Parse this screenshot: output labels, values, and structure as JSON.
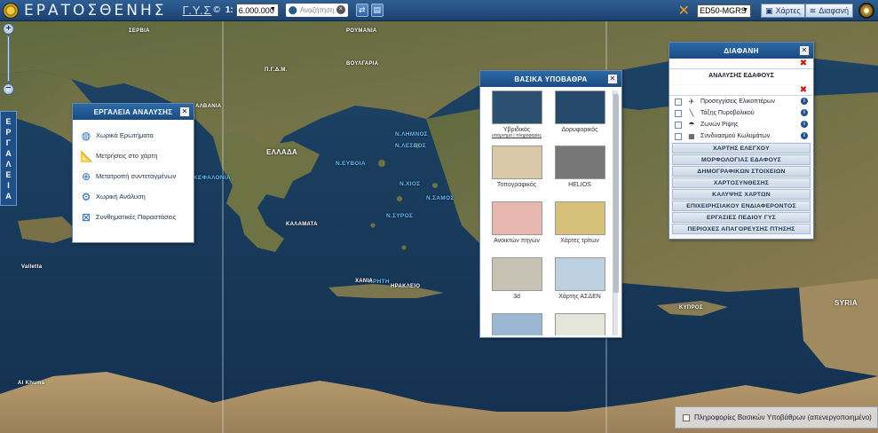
{
  "header": {
    "title": "ΕΡΑΤΟΣΘΕΝΗΣ",
    "gis_logo": "Γ.Υ.Σ",
    "copyright": "©",
    "scale_prefix": "1:",
    "scale_value": "6.000.000",
    "search_placeholder": "Αναζήτηση",
    "coordinate_system": "ED50-MGRS",
    "maps_label": "Χάρτες",
    "legend_label": "Διαφανή"
  },
  "left_tools": {
    "tab_letters": [
      "Ε",
      "Ρ",
      "Γ",
      "Α",
      "Λ",
      "Ε",
      "Ι",
      "Α"
    ]
  },
  "analysis_panel": {
    "title": "ΕΡΓΑΛΕΙΑ ΑΝΑΛΥΣΗΣ",
    "items": [
      {
        "label": "Χωρικά Ερωτήματα",
        "icon": "globe-icon"
      },
      {
        "label": "Μετρήσεις στο χάρτη",
        "icon": "ruler-icon"
      },
      {
        "label": "Μετατροπή συντεταγμένων",
        "icon": "crosshair-icon"
      },
      {
        "label": "Χωρική Ανάλυση",
        "icon": "gear-icon"
      },
      {
        "label": "Συνθηματικές Παραστάσεις",
        "icon": "tactical-symbol-icon"
      }
    ]
  },
  "basemaps_panel": {
    "title": "ΒΑΣΙΚΑ ΥΠΟΒΑΘΡΑ",
    "items": [
      {
        "label": "Υβριδικός",
        "sub": "υπόμνημα | πληροφορίες",
        "swatch": "#2c5070"
      },
      {
        "label": "Δορυφορικός",
        "sub": "",
        "swatch": "#24496b"
      },
      {
        "label": "Τοπογραφικός",
        "sub": "",
        "swatch": "#d9c9a8"
      },
      {
        "label": "HELIOS",
        "sub": "",
        "swatch": "#777"
      },
      {
        "label": "Ανοικτών πηγών",
        "sub": "",
        "swatch": "#e8b8b0"
      },
      {
        "label": "Χάρτες τρίτων",
        "sub": "",
        "swatch": "#d7c07a"
      },
      {
        "label": "3d",
        "sub": "",
        "swatch": "#c8c2b4"
      },
      {
        "label": "Χάρτης ΑΣΔΕΝ",
        "sub": "",
        "swatch": "#bcd0e0"
      },
      {
        "label": "",
        "sub": "",
        "swatch": "#9ab8d2"
      },
      {
        "label": "",
        "sub": "",
        "swatch": "#e3e6d8"
      }
    ]
  },
  "legend_panel": {
    "title": "ΔΙΑΦΑΝΗ",
    "terrain_title": "ΑΝΑΛΥΣΗΣ ΕΔΑΦΟΥΣ",
    "layers": [
      {
        "label": "Προσεγγίσεις Ελικοπτέρων",
        "symbol": "✈"
      },
      {
        "label": "Τάξης Πυροβολικού",
        "symbol": "╲"
      },
      {
        "label": "Ζωνών Ρίψης",
        "symbol": "☂"
      },
      {
        "label": "Συνδυασμού Κωλυμάτων",
        "symbol": "▦"
      }
    ],
    "categories": [
      "ΧΑΡΤΗΣ ΕΛΕΓΧΟΥ",
      "ΜΟΡΦΟΛΟΓΙΑΣ ΕΔΑΦΟΥΣ",
      "ΔΗΜΟΓΡΑΦΙΚΩΝ ΣΤΟΙΧΕΙΩΝ",
      "ΧΑΡΤΟΣΥΝΘΕΣΗΣ",
      "ΚΑΛΥΨΗΣ ΧΑΡΤΩΝ",
      "ΕΠΙΧΕΙΡΗΣΙΑΚΟΥ ΕΝΔΙΑΦΕΡΟΝΤΟΣ",
      "ΕΡΓΑΣΙΕΣ ΠΕΔΙΟΥ ΓΥΣ",
      "ΠΕΡΙΟΧΕΣ ΑΠΑΓΟΡΕΥΣΗΣ ΠΤΗΣΗΣ"
    ]
  },
  "map_labels": [
    {
      "text": "ΣΕΡΒΙΑ",
      "cls": ""
    },
    {
      "text": "ΡΟΥΜΑΝΙΑ",
      "cls": ""
    },
    {
      "text": "ΒΟΥΛΓΑΡΙΑ",
      "cls": ""
    },
    {
      "text": "Π.Γ.Δ.Μ.",
      "cls": ""
    },
    {
      "text": "ΑΛΒΑΝΙΑ",
      "cls": ""
    },
    {
      "text": "ΕΛΛΑΔΑ",
      "cls": "big"
    },
    {
      "text": "Ν.ΛΗΜΝΟΣ",
      "cls": "sea"
    },
    {
      "text": "Ν.ΛΕΣΒΟΣ",
      "cls": "sea"
    },
    {
      "text": "Ν.ΕΥΒΟΙΑ",
      "cls": "sea"
    },
    {
      "text": "Ν.ΧΙΟΣ",
      "cls": "sea"
    },
    {
      "text": "Ν.ΣΑΜΟΣ",
      "cls": "sea"
    },
    {
      "text": "Ν.ΣΥΡΟΣ",
      "cls": "sea"
    },
    {
      "text": "ΚΕΦΑΛΟΝΙΑ",
      "cls": "sea"
    },
    {
      "text": "ΚΡΗΤΗ",
      "cls": "sea"
    },
    {
      "text": "ΚΑΛΑΜΑΤΑ",
      "cls": ""
    },
    {
      "text": "ΧΑΝΙΑ",
      "cls": ""
    },
    {
      "text": "ΗΡΑΚΛΕΙΟ",
      "cls": ""
    },
    {
      "text": "Valletta",
      "cls": ""
    },
    {
      "text": "ΚΥΠΡΟΣ",
      "cls": ""
    },
    {
      "text": "SYRIA",
      "cls": "big"
    },
    {
      "text": "Al Khums",
      "cls": ""
    }
  ],
  "base_info": {
    "label": "Πληροφορίες Βασικών Υποβάθρων (απενεργοποιημένο)"
  },
  "colors": {
    "header_bg": "#1c4170",
    "sea": "#1a3a5c",
    "land": "#7a7048",
    "panel_head": "#1b4b82",
    "close_red": "#d01010"
  }
}
